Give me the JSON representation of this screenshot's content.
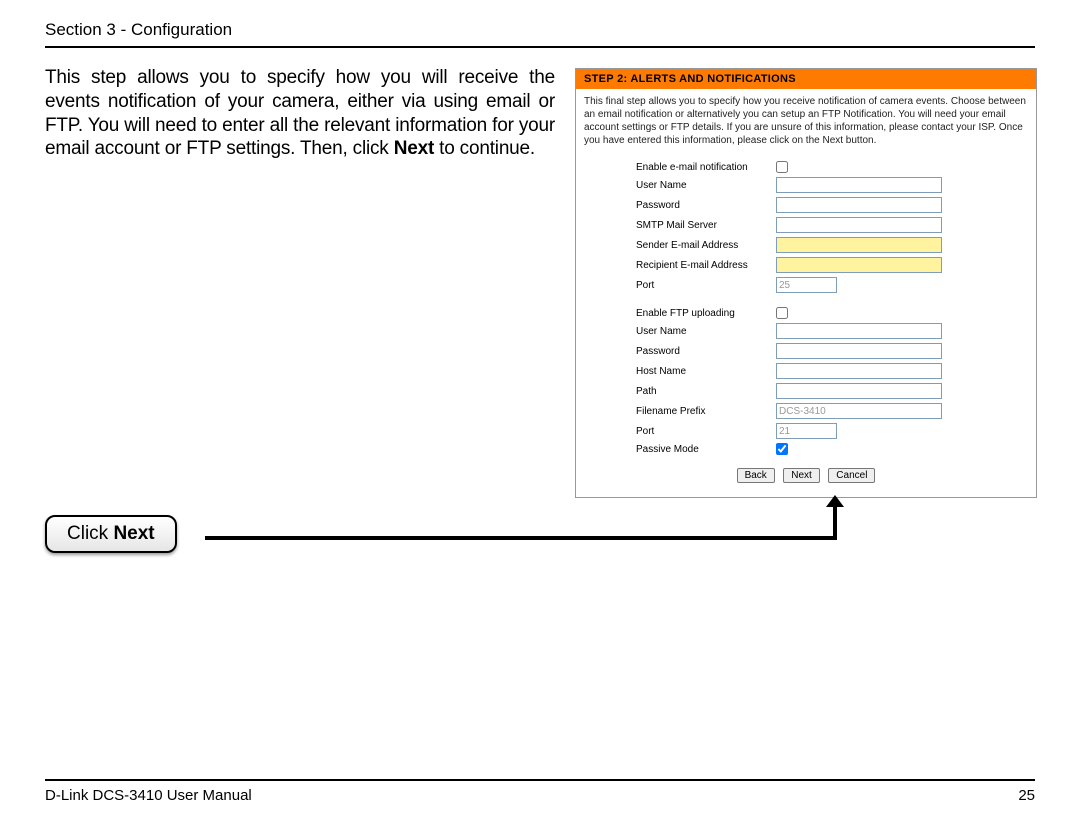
{
  "header": {
    "title": "Section 3 - Configuration"
  },
  "intro": {
    "t1": "This step allows you to specify how you will receive the events notification of your camera, either via using email or FTP. You will need to enter all the relevant information for your email account or FTP settings. Then, click ",
    "bold": "Next",
    "t2": " to continue."
  },
  "panel": {
    "title": "STEP 2: ALERTS AND NOTIFICATIONS",
    "desc": "This final step allows you to specify how you receive notification of camera events. Choose between an email notification or alternatively you can setup an FTP Notification. You will need your email account settings or FTP details. If you are unsure of this information, please contact your ISP. Once you have entered this information, please click on the Next button.",
    "email": {
      "enable_label": "Enable e-mail notification",
      "user_label": "User Name",
      "user_val": "",
      "pass_label": "Password",
      "pass_val": "",
      "smtp_label": "SMTP Mail Server",
      "smtp_val": "",
      "sender_label": "Sender E-mail Address",
      "sender_val": "",
      "recip_label": "Recipient E-mail Address",
      "recip_val": "",
      "port_label": "Port",
      "port_val": "25"
    },
    "ftp": {
      "enable_label": "Enable FTP uploading",
      "user_label": "User Name",
      "user_val": "",
      "pass_label": "Password",
      "pass_val": "",
      "host_label": "Host Name",
      "host_val": "",
      "path_label": "Path",
      "path_val": "",
      "prefix_label": "Filename Prefix",
      "prefix_val": "DCS-3410",
      "port_label": "Port",
      "port_val": "21",
      "passive_label": "Passive Mode"
    },
    "buttons": {
      "back": "Back",
      "next": "Next",
      "cancel": "Cancel"
    }
  },
  "callout": {
    "t1": "Click ",
    "bold": "Next"
  },
  "footer": {
    "left": "D-Link DCS-3410 User Manual",
    "right": "25"
  }
}
